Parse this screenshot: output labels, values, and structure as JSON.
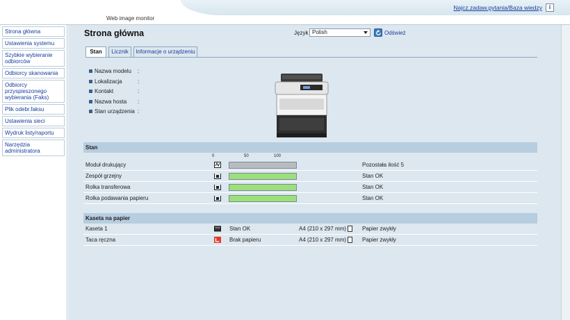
{
  "header": {
    "title": "Web image monitor",
    "faq_link": "Najcz.zadaw.pytania/Baza wiedzy",
    "help_icon": "info-icon"
  },
  "sidebar": {
    "items": [
      {
        "label": "Strona główna"
      },
      {
        "label": "Ustawienia systemu"
      },
      {
        "label": "Szybkie wybieranie odbiorców"
      },
      {
        "label": "Odbiorcy skanowania"
      },
      {
        "label": "Odbiorcy przyspieszonego wybierania (Faks)"
      },
      {
        "label": "Plik odebr.faksu"
      },
      {
        "label": "Ustawienia sieci"
      },
      {
        "label": "Wydruk listy/raportu"
      },
      {
        "label": "Narzędzia administratora"
      }
    ]
  },
  "main": {
    "title": "Strona główna",
    "language_label": "Język",
    "language_value": "Polish",
    "refresh_label": "Odśwież",
    "tabs": [
      {
        "label": "Stan",
        "active": true
      },
      {
        "label": "Licznik",
        "active": false
      },
      {
        "label": "Informacje o urządzeniu",
        "active": false
      }
    ],
    "info": [
      {
        "label": "Nazwa modelu",
        "colon": ":"
      },
      {
        "label": "Lokalizacja",
        "colon": ":"
      },
      {
        "label": "Kontakt",
        "colon": ":"
      },
      {
        "label": "Nazwa hosta",
        "colon": ":"
      },
      {
        "label": "Stan urządzenia",
        "colon": ":"
      }
    ],
    "status_section": {
      "title": "Stan",
      "scale": [
        "0",
        "50",
        "100"
      ],
      "rows": [
        {
          "label": "Moduł drukujący",
          "level": 1.0,
          "bar_color": "#b9bcbf",
          "status": "Pozostała ilość 5",
          "icon": "toner-icon"
        },
        {
          "label": "Zespół grzejny",
          "level": 1.0,
          "bar_color": "#9be07a",
          "status": "Stan OK",
          "icon": "fuser-icon"
        },
        {
          "label": "Rolka transferowa",
          "level": 1.0,
          "bar_color": "#9be07a",
          "status": "Stan OK",
          "icon": "transfer-roller-icon"
        },
        {
          "label": "Rolka podawania papieru",
          "level": 1.0,
          "bar_color": "#9be07a",
          "status": "Stan OK",
          "icon": "feed-roller-icon"
        }
      ]
    },
    "paper_section": {
      "title": "Kaseta na papier",
      "rows": [
        {
          "label": "Kaseta 1",
          "status": "Stan OK",
          "size": "A4 (210 x 297 mm)",
          "type": "Papier zwykły",
          "icon": "tray-ok-icon"
        },
        {
          "label": "Taca ręczna",
          "status": "Brak papieru",
          "size": "A4 (210 x 297 mm)",
          "type": "Papier zwykły",
          "icon": "tray-empty-icon"
        }
      ]
    }
  },
  "colors": {
    "accent_link": "#1a3d9c",
    "section_header": "#b7cde0",
    "main_bg": "#dde7ef",
    "ok_green": "#9be07a",
    "error_red": "#e03a2a"
  }
}
